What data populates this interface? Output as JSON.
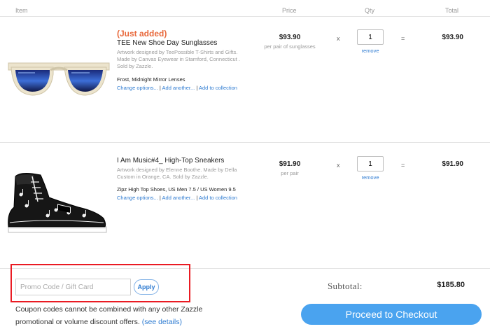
{
  "header": {
    "item": "Item",
    "price": "Price",
    "qty": "Qty",
    "total": "Total"
  },
  "items": [
    {
      "badge": "(Just added)",
      "name": "TEE New Shoe Day Sunglasses",
      "description": "Artwork designed by TeePossible T-Shirts and Gifts. Made by Canvas Eyewear in Stamford, Connecticut . Sold by Zazzle.",
      "option": "Frost, Midnight Mirror Lenses",
      "change_label": "Change options...",
      "add_another_label": "Add another...",
      "collection_label": "Add to collection",
      "price": "$93.90",
      "price_unit": "per pair of sunglasses",
      "times": "x",
      "qty": "1",
      "remove_label": "remove",
      "equals": "=",
      "total": "$93.90",
      "image_icon": "sunglasses-image"
    },
    {
      "badge": "",
      "name": "I Am Music#4_ High-Top Sneakers",
      "description": "Artwork designed by Elenne Boothe. Made by Della Custom in Orange, CA. Sold by Zazzle.",
      "option": "Zipz High Top Shoes, US Men 7.5 / US Women 9.5",
      "change_label": "Change options...",
      "add_another_label": "Add another...",
      "collection_label": "Add to collection",
      "price": "$91.90",
      "price_unit": "per pair",
      "times": "x",
      "qty": "1",
      "remove_label": "remove",
      "equals": "=",
      "total": "$91.90",
      "image_icon": "sneaker-image"
    }
  ],
  "separator": "|",
  "promo": {
    "placeholder": "Promo Code / Gift Card",
    "apply_label": "Apply"
  },
  "coupon_note": "Coupon codes cannot be combined with any other Zazzle promotional or volume discount offers.",
  "see_details": "(see details)",
  "subtotal": {
    "label": "Subtotal:",
    "value": "$185.80"
  },
  "checkout_label": "Proceed to Checkout",
  "colors": {
    "accent": "#4aa3ef",
    "link": "#2e7bd1",
    "just_added": "#e8693c",
    "highlight": "#ea1b23"
  }
}
